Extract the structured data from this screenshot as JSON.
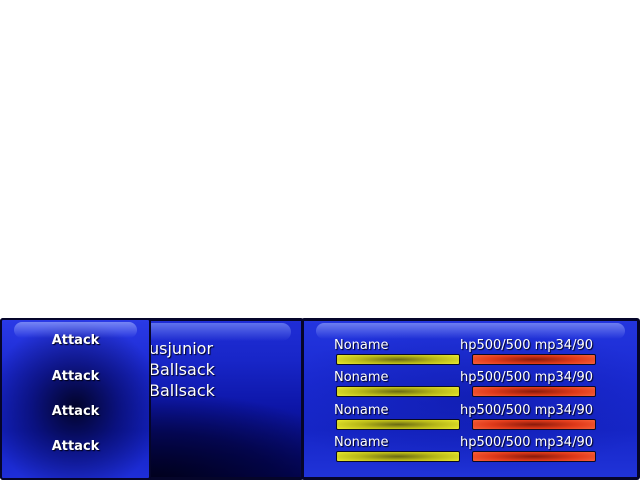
{
  "colors": {
    "panel_blue": "#1a28d0",
    "panel_border": "#05052a",
    "hp_bar": "#f4f432",
    "mp_bar": "#e03a1a",
    "text": "#ffffff"
  },
  "targets": [
    {
      "name": "usjunior"
    },
    {
      "name": "Ballsack"
    },
    {
      "name": "Ballsack"
    }
  ],
  "commands": [
    {
      "label": "Attack"
    },
    {
      "label": "Attack"
    },
    {
      "label": "Attack"
    },
    {
      "label": "Attack"
    }
  ],
  "party": [
    {
      "name": "Noname",
      "hp_text": "hp500/500",
      "mp_text": "mp34/90",
      "hp_fraction": 1.0,
      "mp_fraction": 1.0
    },
    {
      "name": "Noname",
      "hp_text": "hp500/500",
      "mp_text": "mp34/90",
      "hp_fraction": 1.0,
      "mp_fraction": 1.0
    },
    {
      "name": "Noname",
      "hp_text": "hp500/500",
      "mp_text": "mp34/90",
      "hp_fraction": 1.0,
      "mp_fraction": 1.0
    },
    {
      "name": "Noname",
      "hp_text": "hp500/500",
      "mp_text": "mp34/90",
      "hp_fraction": 1.0,
      "mp_fraction": 1.0
    }
  ]
}
